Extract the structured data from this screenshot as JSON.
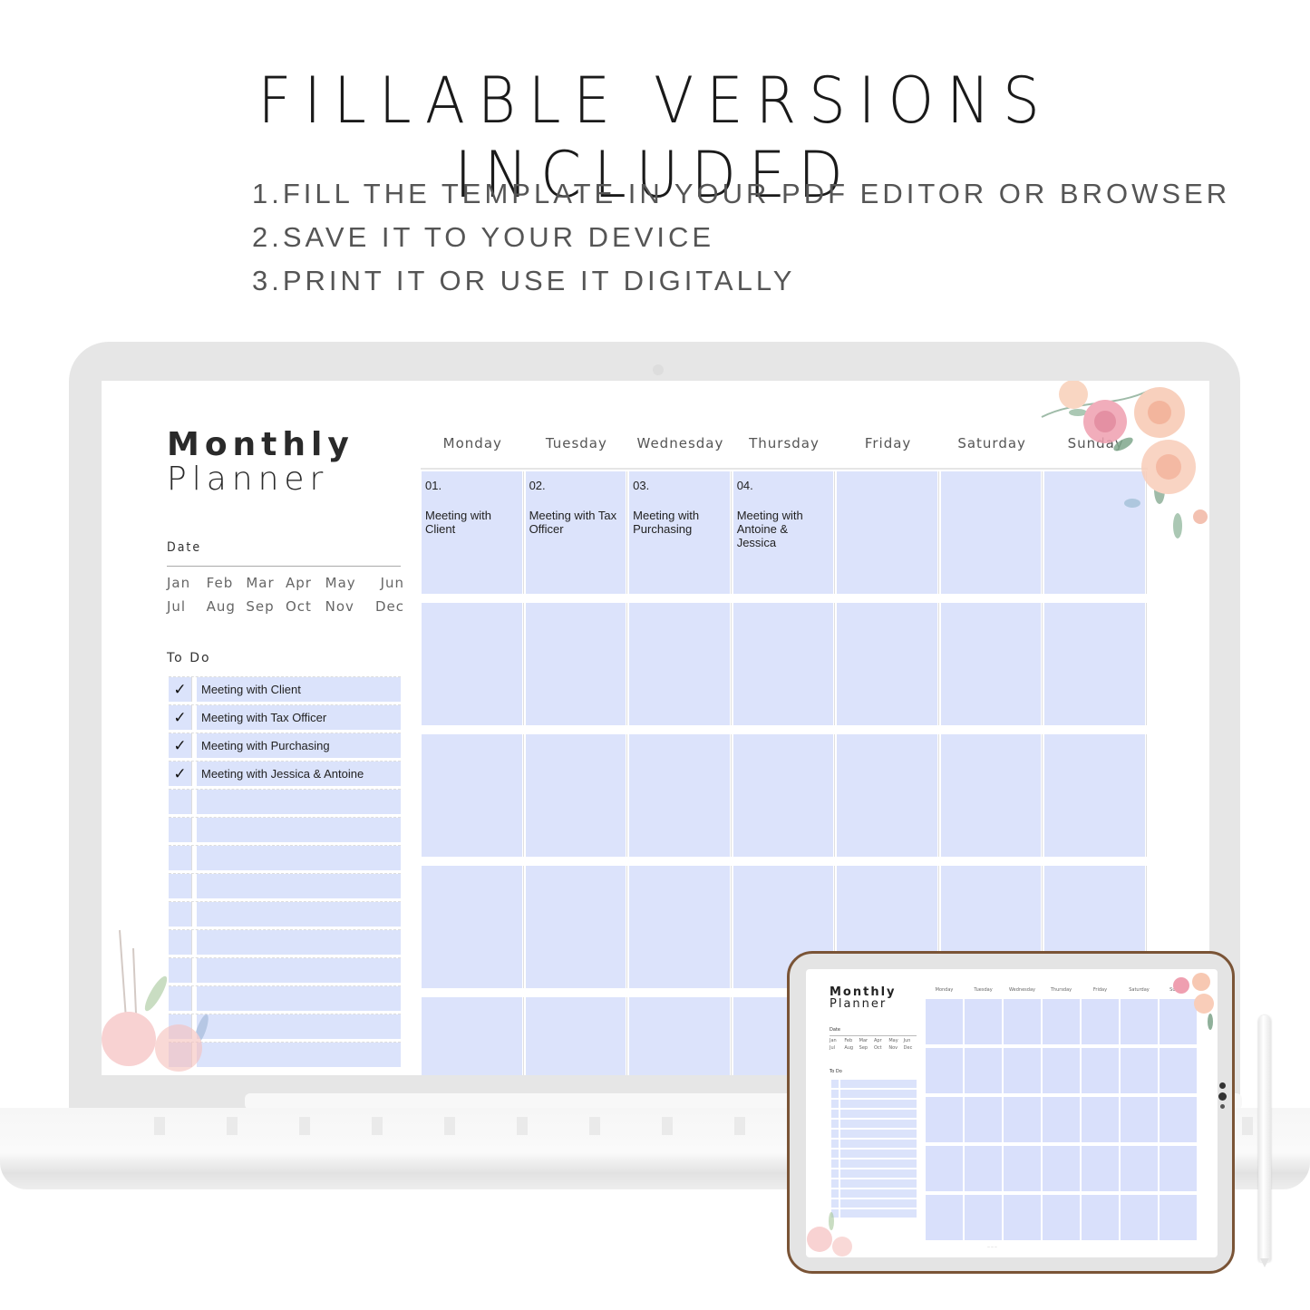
{
  "headline": "FILLABLE VERSIONS INCLUDED",
  "steps": [
    "1.FILL THE TEMPLATE IN YOUR PDF EDITOR OR BROWSER",
    "2.SAVE IT TO YOUR DEVICE",
    "3.PRINT IT OR USE IT DIGITALLY"
  ],
  "planner": {
    "title_line1": "Monthly",
    "title_line2": "Planner",
    "date_label": "Date",
    "months": [
      "Jan",
      "Feb",
      "Mar",
      "Apr",
      "May",
      "Jun",
      "Jul",
      "Aug",
      "Sep",
      "Oct",
      "Nov",
      "Dec"
    ],
    "todo_label": "To Do",
    "todo_items": [
      {
        "checked": "✓",
        "text": "Meeting with Client"
      },
      {
        "checked": "✓",
        "text": "Meeting with Tax Officer"
      },
      {
        "checked": "✓",
        "text": "Meeting with Purchasing"
      },
      {
        "checked": "✓",
        "text": "Meeting with Jessica & Antoine"
      },
      {
        "checked": "",
        "text": ""
      },
      {
        "checked": "",
        "text": ""
      },
      {
        "checked": "",
        "text": ""
      },
      {
        "checked": "",
        "text": ""
      },
      {
        "checked": "",
        "text": ""
      },
      {
        "checked": "",
        "text": ""
      },
      {
        "checked": "",
        "text": ""
      },
      {
        "checked": "",
        "text": ""
      },
      {
        "checked": "",
        "text": ""
      },
      {
        "checked": "",
        "text": ""
      }
    ],
    "days": [
      "Monday",
      "Tuesday",
      "Wednesday",
      "Thursday",
      "Friday",
      "Saturday",
      "Sunday"
    ],
    "first_week_entries": [
      {
        "num": "01.",
        "text": "Meeting with Client"
      },
      {
        "num": "02.",
        "text": "Meeting with Tax Officer"
      },
      {
        "num": "03.",
        "text": "Meeting with Purchasing"
      },
      {
        "num": "04.",
        "text": "Meeting with Antoine & Jessica"
      },
      {
        "num": "",
        "text": ""
      },
      {
        "num": "",
        "text": ""
      },
      {
        "num": "",
        "text": ""
      }
    ],
    "weeks_visible": 5
  },
  "tablet": {
    "title_line1": "Monthly",
    "title_line2": "Planner",
    "date_label": "Date",
    "todo_label": "To Do",
    "footer": "— — —"
  },
  "colors": {
    "cell_fill": "#dce3fb",
    "tablet_frame": "#7a5436",
    "laptop_body": "#e6e6e6"
  }
}
